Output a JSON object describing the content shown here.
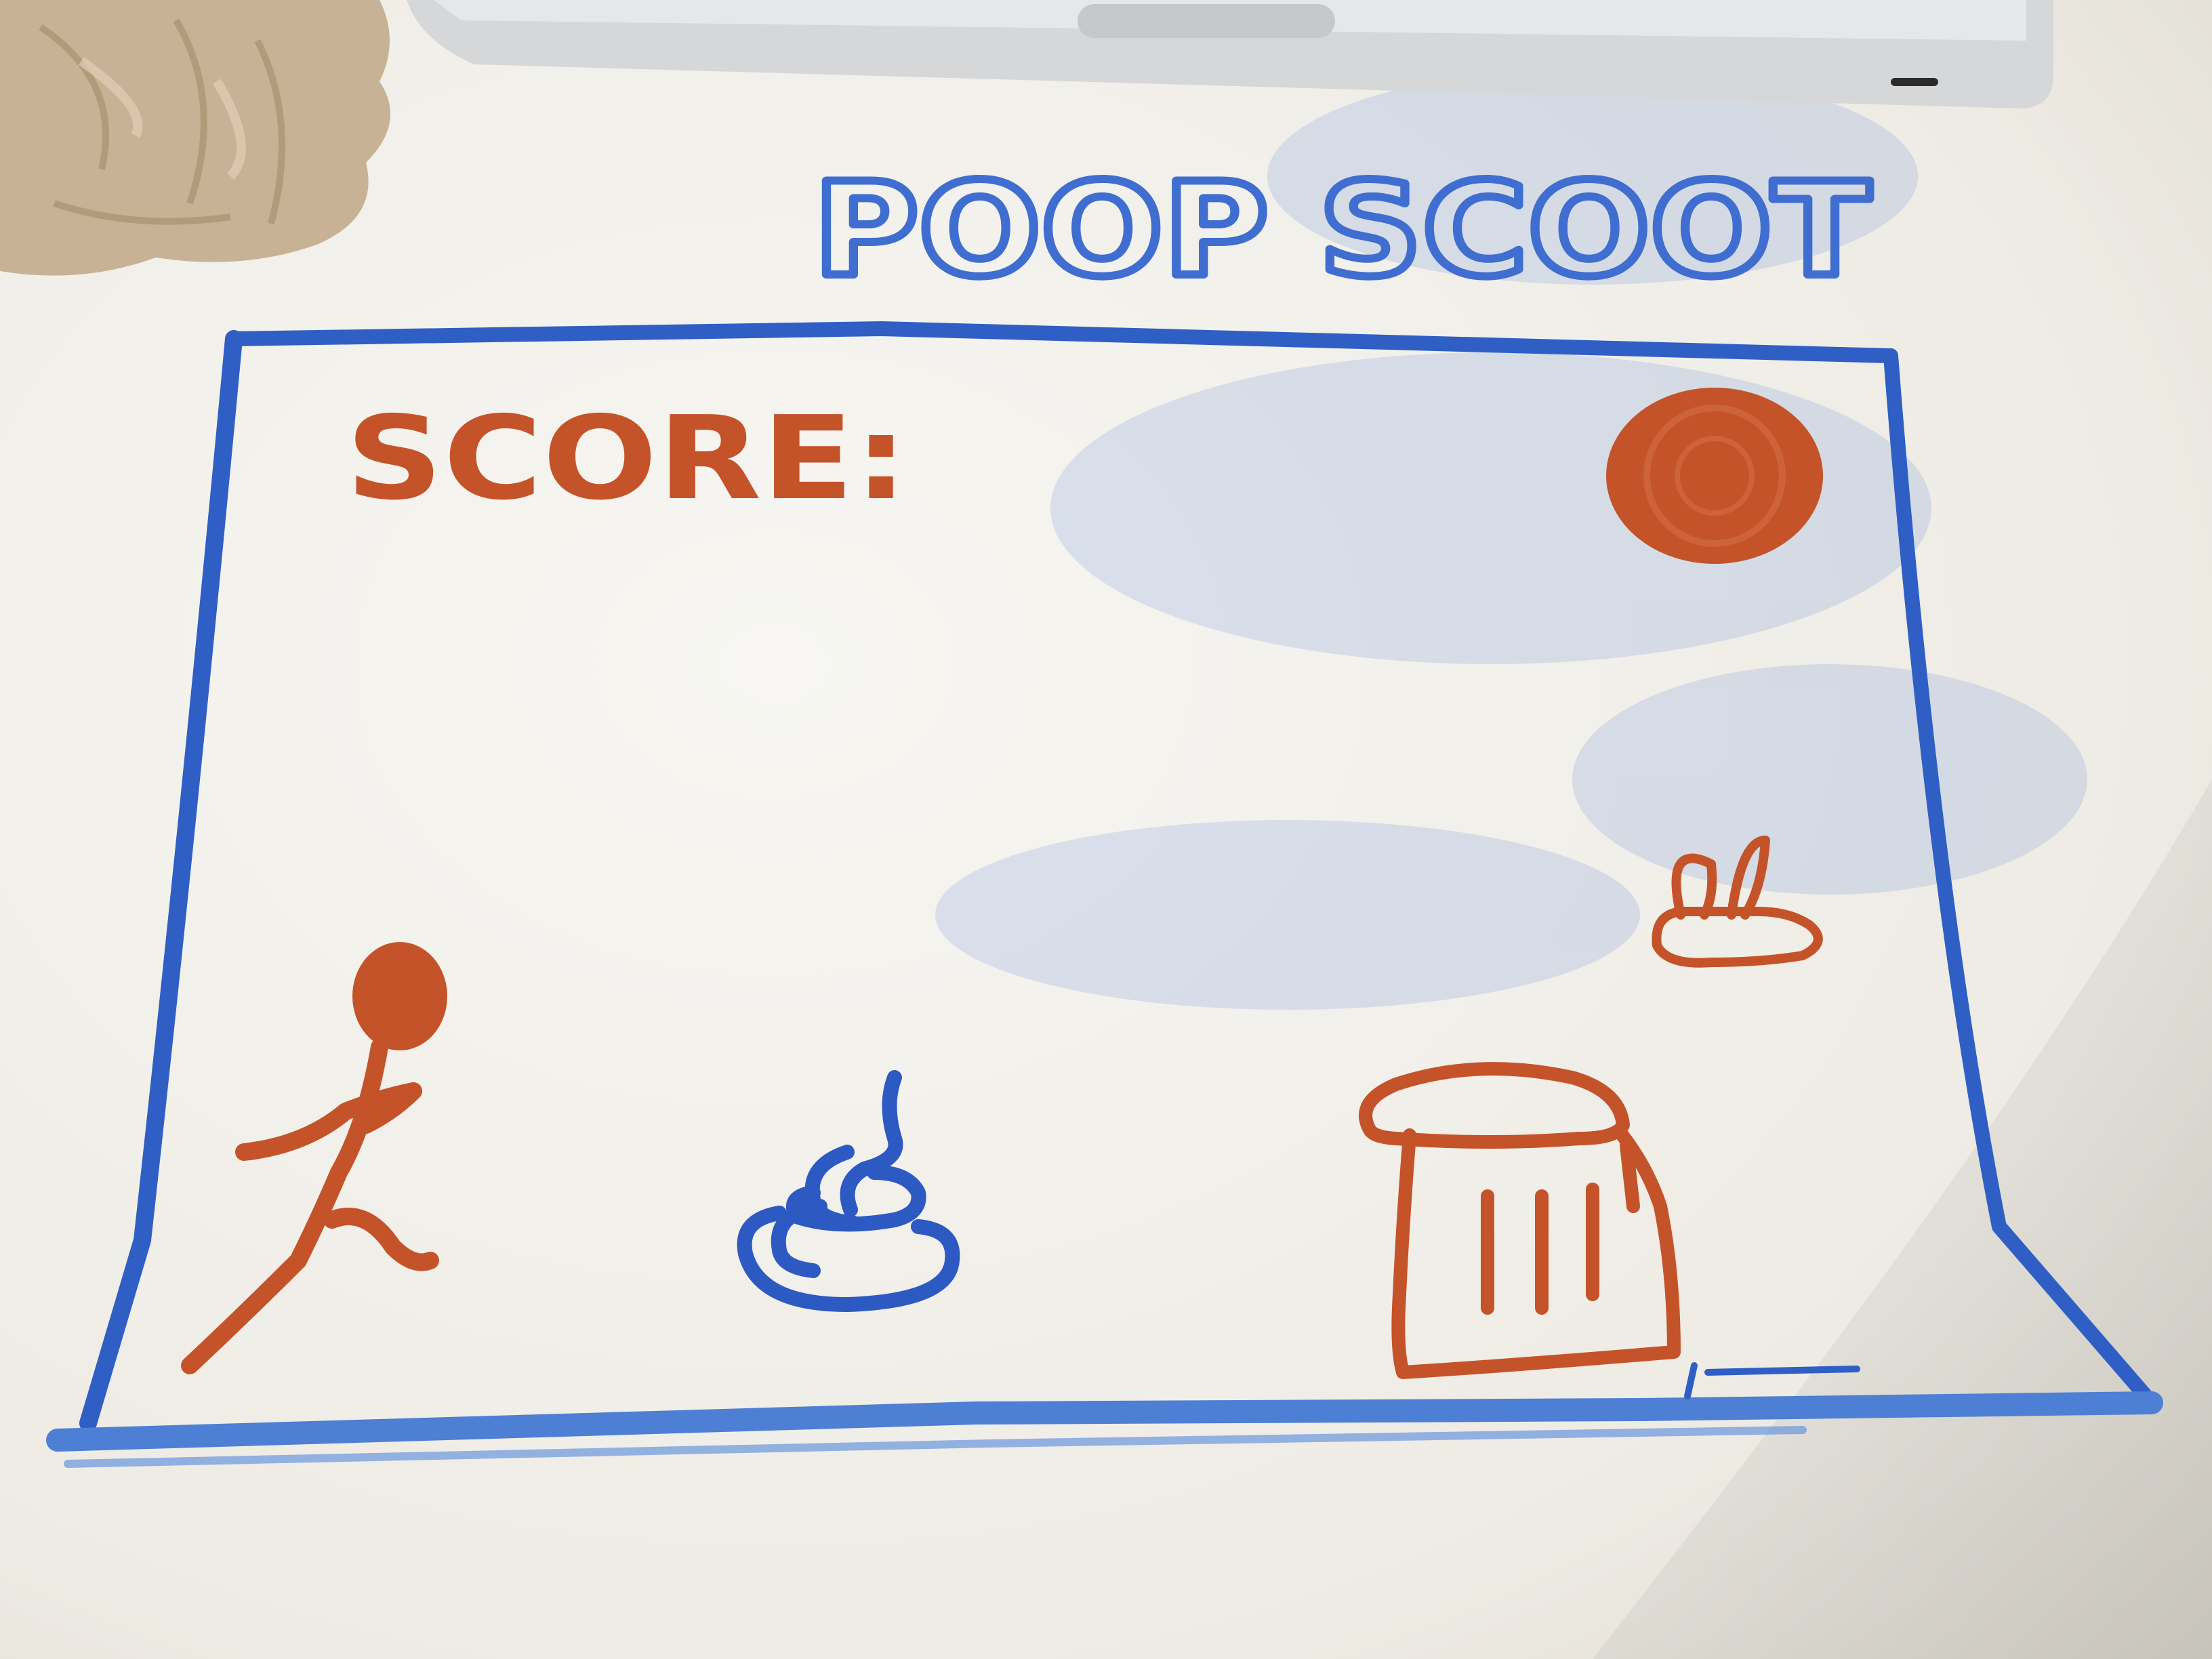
{
  "game": {
    "title": "POOP SCOOT",
    "score_label": "SCORE:"
  },
  "colors": {
    "board": "#f4f2ec",
    "marker_blue": "#2f5fc4",
    "marker_orange": "#c4532a",
    "laptop": "#d9dadb",
    "paper_bag": "#c8b296"
  },
  "icons": {
    "sun": "sun-icon",
    "player": "stick-figure-runner-icon",
    "poop": "poop-icon",
    "trash_can": "trash-can-icon",
    "flying_enemy": "fly-icon"
  }
}
